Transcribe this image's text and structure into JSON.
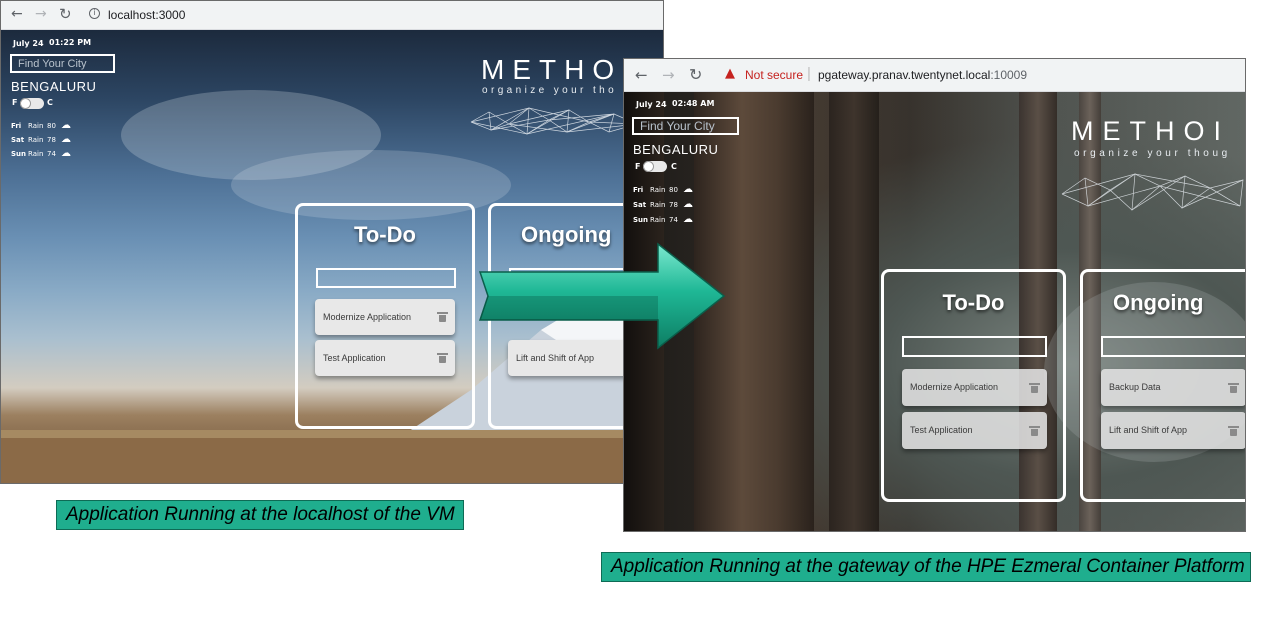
{
  "left_window": {
    "url": "localhost:3000",
    "date": "July 24",
    "time": "01:22 PM",
    "city_placeholder": "Find Your City",
    "city": "BENGALURU",
    "unit_f": "F",
    "unit_c": "C",
    "forecast": [
      {
        "day": "Fri",
        "cond": "Rain",
        "temp": "80"
      },
      {
        "day": "Sat",
        "cond": "Rain",
        "temp": "78"
      },
      {
        "day": "Sun",
        "cond": "Rain",
        "temp": "74"
      }
    ],
    "brand": "METHO",
    "tagline": "organize your tho",
    "todo_title": "To-Do",
    "todo_items": [
      "Modernize Application",
      "Test Application"
    ],
    "ongoing_title": "Ongoing",
    "ongoing_items": [
      "Lift and Shift of App"
    ]
  },
  "right_window": {
    "security": "Not secure",
    "url_host": "pgateway.pranav.twentynet.local",
    "url_port": ":10009",
    "date": "July 24",
    "time": "02:48 AM",
    "city_placeholder": "Find Your City",
    "city": "BENGALURU",
    "unit_f": "F",
    "unit_c": "C",
    "forecast": [
      {
        "day": "Fri",
        "cond": "Rain",
        "temp": "80"
      },
      {
        "day": "Sat",
        "cond": "Rain",
        "temp": "78"
      },
      {
        "day": "Sun",
        "cond": "Rain",
        "temp": "74"
      }
    ],
    "brand": "METHOI",
    "tagline": "organize your thoug",
    "todo_title": "To-Do",
    "todo_items": [
      "Modernize Application",
      "Test Application"
    ],
    "ongoing_title": "Ongoing",
    "ongoing_items": [
      "Backup Data",
      "Lift and Shift of App"
    ]
  },
  "captions": {
    "left": "Application Running at the localhost of the VM",
    "right": "Application Running at the gateway of the HPE Ezmeral Container Platform"
  },
  "colors": {
    "caption_bg": "#1fae8e",
    "arrow": "#1fb896",
    "not_secure": "#c5221f"
  }
}
